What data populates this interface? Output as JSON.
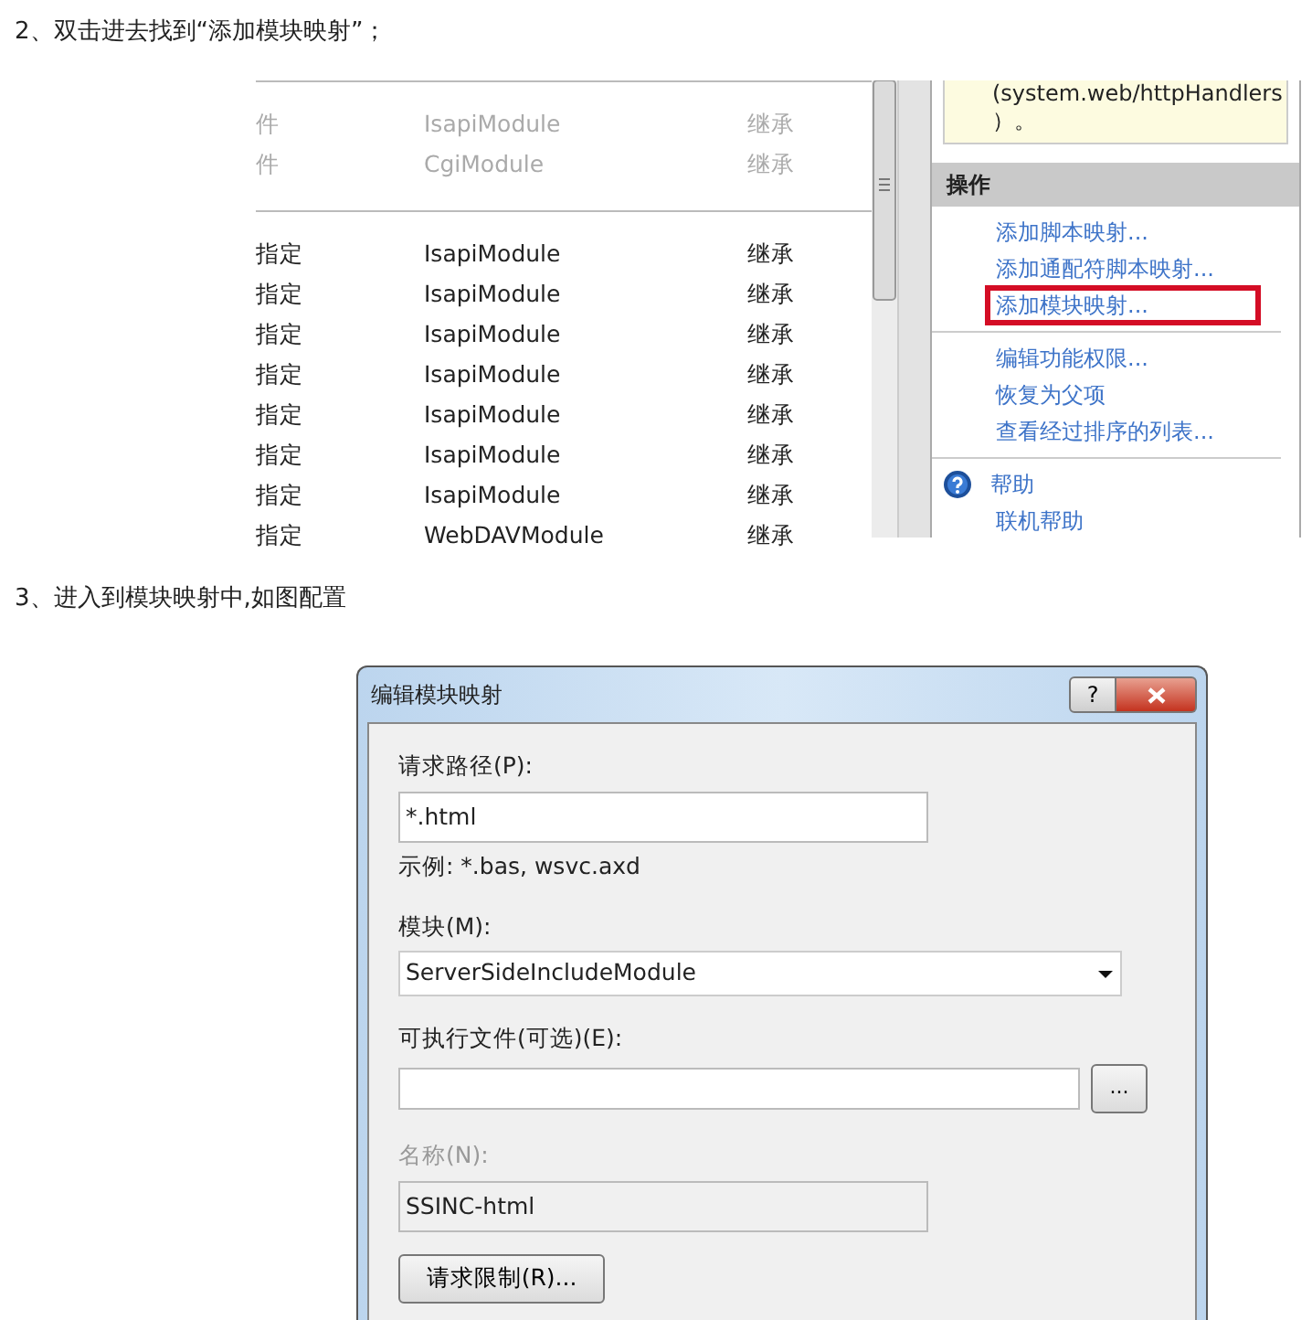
{
  "step_2": {
    "text": "2、双击进去找到“添加模块映射”；"
  },
  "iis_screenshot": {
    "table": {
      "rows": [
        {
          "column_1": "件",
          "column_2": "IsapiModule",
          "column_3": "继承",
          "greyed": true
        },
        {
          "column_1": "件",
          "column_2": "CgiModule",
          "column_3": "继承",
          "greyed": true
        },
        {
          "column_1": "指定",
          "column_2": "IsapiModule",
          "column_3": "继承",
          "greyed": false
        },
        {
          "column_1": "指定",
          "column_2": "IsapiModule",
          "column_3": "继承",
          "greyed": false
        },
        {
          "column_1": "指定",
          "column_2": "IsapiModule",
          "column_3": "继承",
          "greyed": false
        },
        {
          "column_1": "指定",
          "column_2": "IsapiModule",
          "column_3": "继承",
          "greyed": false
        },
        {
          "column_1": "指定",
          "column_2": "IsapiModule",
          "column_3": "继承",
          "greyed": false
        },
        {
          "column_1": "指定",
          "column_2": "IsapiModule",
          "column_3": "继承",
          "greyed": false
        },
        {
          "column_1": "指定",
          "column_2": "IsapiModule",
          "column_3": "继承",
          "greyed": false
        },
        {
          "column_1": "指定",
          "column_2": "WebDAVModule",
          "column_3": "继承",
          "greyed": false
        }
      ]
    },
    "info_box": {
      "lines": [
        "(system.web/httpHandlers",
        "）。"
      ]
    },
    "actions": {
      "title": "操作",
      "groups": [
        [
          {
            "label": "添加脚本映射...",
            "kind": "link",
            "highlighted": false
          },
          {
            "label": "添加通配符脚本映射...",
            "kind": "link",
            "highlighted": false
          },
          {
            "label": "添加模块映射...",
            "kind": "link",
            "highlighted": true
          }
        ],
        [
          {
            "label": "编辑功能权限...",
            "kind": "link",
            "highlighted": false
          },
          {
            "label": "恢复为父项",
            "kind": "link",
            "highlighted": false
          },
          {
            "label": "查看经过排序的列表...",
            "kind": "link",
            "highlighted": false
          }
        ],
        [
          {
            "label": "帮助",
            "kind": "help",
            "highlighted": false
          },
          {
            "label": "联机帮助",
            "kind": "link",
            "highlighted": false
          }
        ]
      ]
    }
  },
  "step_3": {
    "text": "3、进入到模块映射中,如图配置"
  },
  "dialog": {
    "title": "编辑模块映射",
    "help_button": "?",
    "request_path": {
      "label": "请求路径(P):",
      "value": "*.html",
      "hint": "示例: *.bas, wsvc.axd"
    },
    "module": {
      "label": "模块(M):",
      "value": "ServerSideIncludeModule"
    },
    "executable": {
      "label": "可执行文件(可选)(E):",
      "browse_button": "..."
    },
    "name": {
      "label": "名称(N):",
      "value": "SSINC-html",
      "disabled": true
    },
    "restrictions_button": "请求限制(R)..."
  }
}
